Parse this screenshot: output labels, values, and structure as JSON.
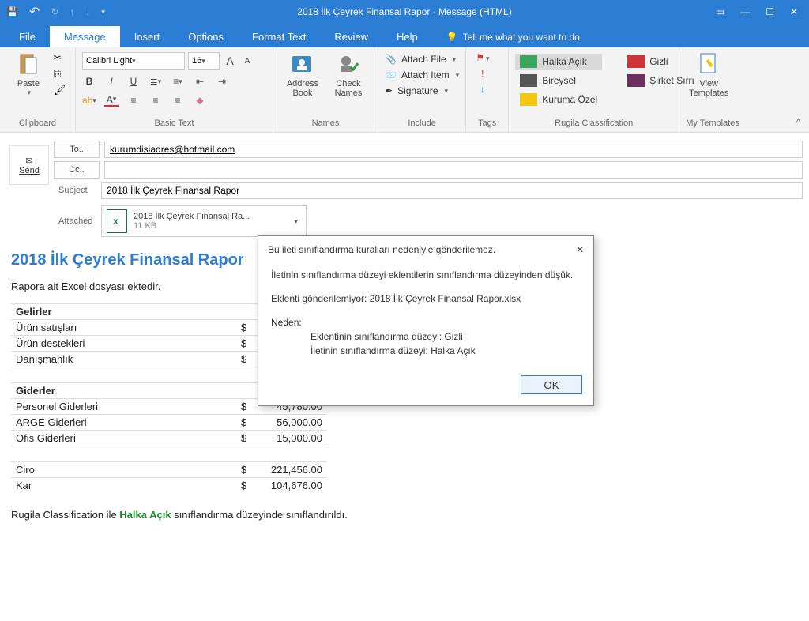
{
  "titlebar": {
    "title": "2018 İlk Çeyrek Finansal Rapor  -  Message (HTML)"
  },
  "tabs": {
    "file": "File",
    "message": "Message",
    "insert": "Insert",
    "options": "Options",
    "format": "Format Text",
    "review": "Review",
    "help": "Help",
    "tellme": "Tell me what you want to do"
  },
  "ribbon": {
    "clipboard": {
      "label": "Clipboard",
      "paste": "Paste"
    },
    "basictext": {
      "label": "Basic Text",
      "font": "Calibri Light",
      "size": "16"
    },
    "names": {
      "label": "Names",
      "address": "Address Book",
      "check": "Check Names"
    },
    "include": {
      "label": "Include",
      "attachfile": "Attach File",
      "attachitem": "Attach Item",
      "signature": "Signature"
    },
    "tags": {
      "label": "Tags"
    },
    "classification": {
      "label": "Rugila Classification",
      "public": "Halka Açık",
      "private": "Gizli",
      "individual": "Bireysel",
      "corpsecret": "Şirket Sırrı",
      "internal": "Kuruma Özel"
    },
    "templates": {
      "label": "My Templates",
      "view": "View Templates"
    }
  },
  "compose": {
    "send": "Send",
    "to_btn": "To..",
    "cc_btn": "Cc..",
    "subject_lbl": "Subject",
    "attached_lbl": "Attached",
    "to_val": "kurumdisiadres@hotmail.com",
    "cc_val": "",
    "subject_val": "2018 İlk Çeyrek Finansal Rapor",
    "attach_name": "2018 İlk Çeyrek Finansal Ra...",
    "attach_size": "11 KB"
  },
  "body": {
    "title": "2018 İlk Çeyrek Finansal Rapor",
    "intro": "Rapora ait Excel dosyası ektedir.",
    "income_head": "Gelirler",
    "income": [
      {
        "name": "Ürün satışları",
        "amount": ""
      },
      {
        "name": "Ürün destekleri",
        "amount": ""
      },
      {
        "name": "Danışmanlık",
        "amount": ""
      }
    ],
    "expense_head": "Giderler",
    "expense": [
      {
        "name": "Personel Giderleri",
        "amount": "45,780.00"
      },
      {
        "name": "ARGE Giderleri",
        "amount": "56,000.00"
      },
      {
        "name": "Ofis Giderleri",
        "amount": "15,000.00"
      }
    ],
    "totals": [
      {
        "name": "Ciro",
        "amount": "221,456.00"
      },
      {
        "name": "Kar",
        "amount": "104,676.00"
      }
    ],
    "footer_pre": "Rugila Classification ile ",
    "footer_class": "Halka Açık",
    "footer_post": " sınıflandırma düzeyinde sınıflandırıldı."
  },
  "dialog": {
    "head": "Bu ileti sınıflandırma kuralları nedeniyle gönderilemez.",
    "line1": "İletinin sınıflandırma düzeyi eklentilerin sınıflandırma düzeyinden düşük.",
    "line2": "Eklenti gönderilemiyor: 2018 İlk Çeyrek Finansal Rapor.xlsx",
    "reason_lbl": "Neden:",
    "reason1": "Eklentinin sınıflandırma düzeyi: Gizli",
    "reason2": "İletinin sınıflandırma düzeyi: Halka Açık",
    "ok": "OK"
  }
}
